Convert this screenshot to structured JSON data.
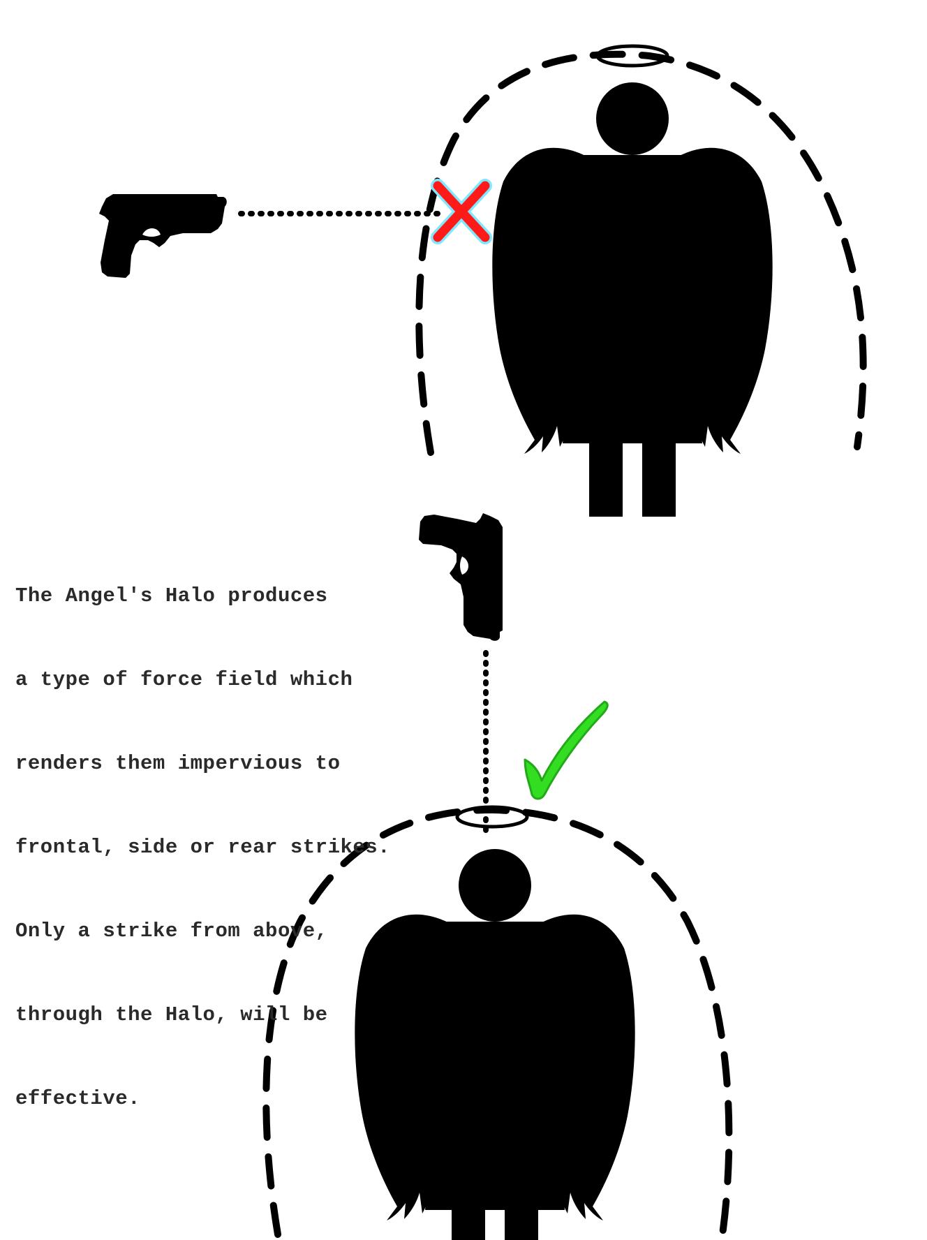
{
  "explanation": {
    "lines": [
      "The Angel's Halo produces",
      "a type of force field which",
      "renders them impervious to",
      "frontal, side or rear strikes.",
      "Only a strike from above,",
      "through the Halo, will be",
      "effective."
    ]
  },
  "colors": {
    "ink": "#000000",
    "text": "#2a2a2a",
    "blocked_mark": "#ff1a1a",
    "blocked_mark_outline": "#7fe8ff",
    "success_mark": "#33dd22",
    "background": "#ffffff"
  },
  "icons": {
    "blocked": "cross-icon",
    "success": "checkmark-icon",
    "weapon": "pistol-icon",
    "figure": "angel-icon",
    "halo": "halo-icon"
  }
}
